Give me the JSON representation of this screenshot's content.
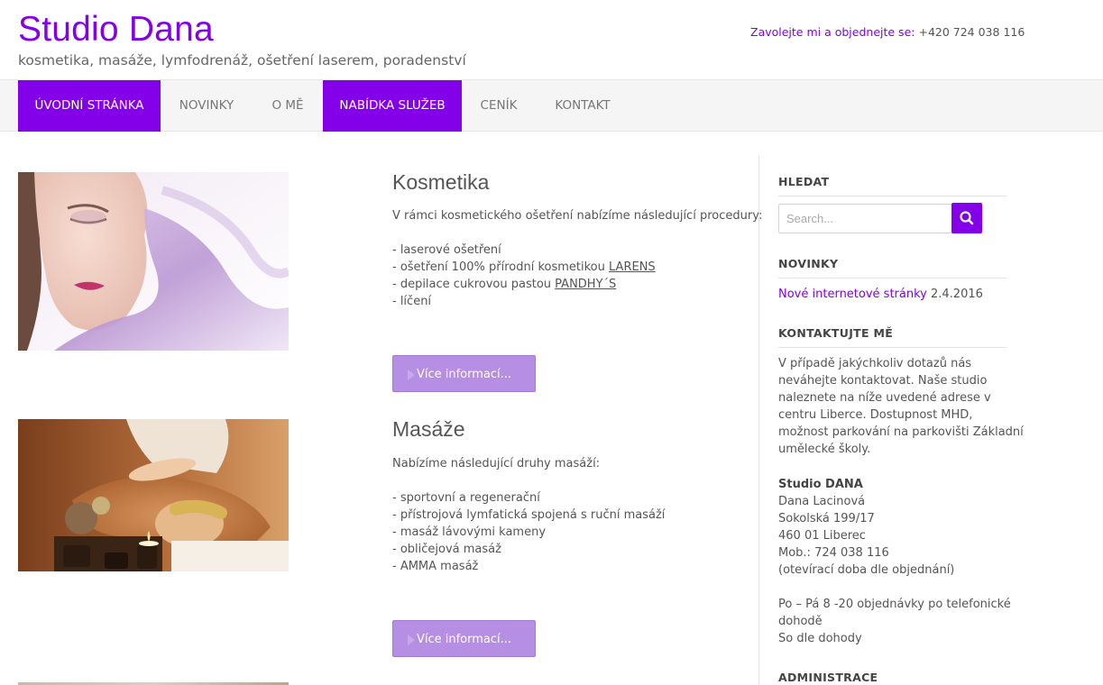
{
  "header": {
    "title": "Studio Dana",
    "tagline": "kosmetika, masáže, lymfodrenáž, ošetření laserem, poradenství",
    "contact_label": "Zavolejte mi a objednejte se:",
    "contact_phone": "+420 724 038 116"
  },
  "nav": {
    "items": [
      {
        "label": "ÚVODNÍ STRÁNKA",
        "active": true
      },
      {
        "label": "NOVINKY",
        "active": false
      },
      {
        "label": "O MĚ",
        "active": false
      },
      {
        "label": "NABÍDKA SLUŽEB",
        "active": true
      },
      {
        "label": "CENÍK",
        "active": false
      },
      {
        "label": "KONTAKT",
        "active": false
      }
    ]
  },
  "services": [
    {
      "title": "Kosmetika",
      "intro": "V rámci kosmetického ošetření nabízíme následující procedury:",
      "items": [
        "- laserové ošetření",
        "- ošetření 100% přírodní kosmetikou",
        "- depilace cukrovou pastou",
        "- líčení"
      ],
      "link_larens": "LARENS",
      "link_pandhys": "PANDHY´S",
      "button": "Více informací..."
    },
    {
      "title": "Masáže",
      "intro": "Nabízíme následující druhy masáží:",
      "items": [
        "- sportovní a regenerační",
        "- přístrojová lymfatická spojená s ruční masáží",
        "- masáž lávovými kameny",
        "- obličejová masáž",
        "- AMMA masáž"
      ],
      "button": "Více informací..."
    }
  ],
  "sidebar": {
    "search": {
      "heading": "HLEDAT",
      "placeholder": "Search...",
      "icon": "search-icon"
    },
    "news": {
      "heading": "NOVINKY",
      "link": "Nové internetové stránky",
      "date": "2.4.2016"
    },
    "contact": {
      "heading": "KONTAKTUJTE MĚ",
      "paragraph": [
        "V případě jakýchkoliv dotazů nás",
        "neváhejte kontaktovat. Naše studio",
        "naleznete na níže uvedené adrese v",
        "centru Liberce. Dostupnost MHD,",
        "možnost parkování na parkovišti Základní",
        "umělecké školy."
      ],
      "name": "Studio DANA",
      "address": [
        "Dana Lacinová",
        "Sokolská 199/17",
        "460 01 Liberec",
        "Mob.: 724 038 116",
        "(otevírací doba dle objednání)"
      ],
      "hours": [
        "Po – Pá 8 -20 objednávky po telefonické",
        "dohodě",
        "So dle dohody"
      ]
    },
    "admin": {
      "heading": "ADMINISTRACE"
    }
  },
  "colors": {
    "accent": "#8300e9",
    "button": "#b68ee3",
    "nav_bg": "#f5f5f5",
    "text": "#555555"
  }
}
